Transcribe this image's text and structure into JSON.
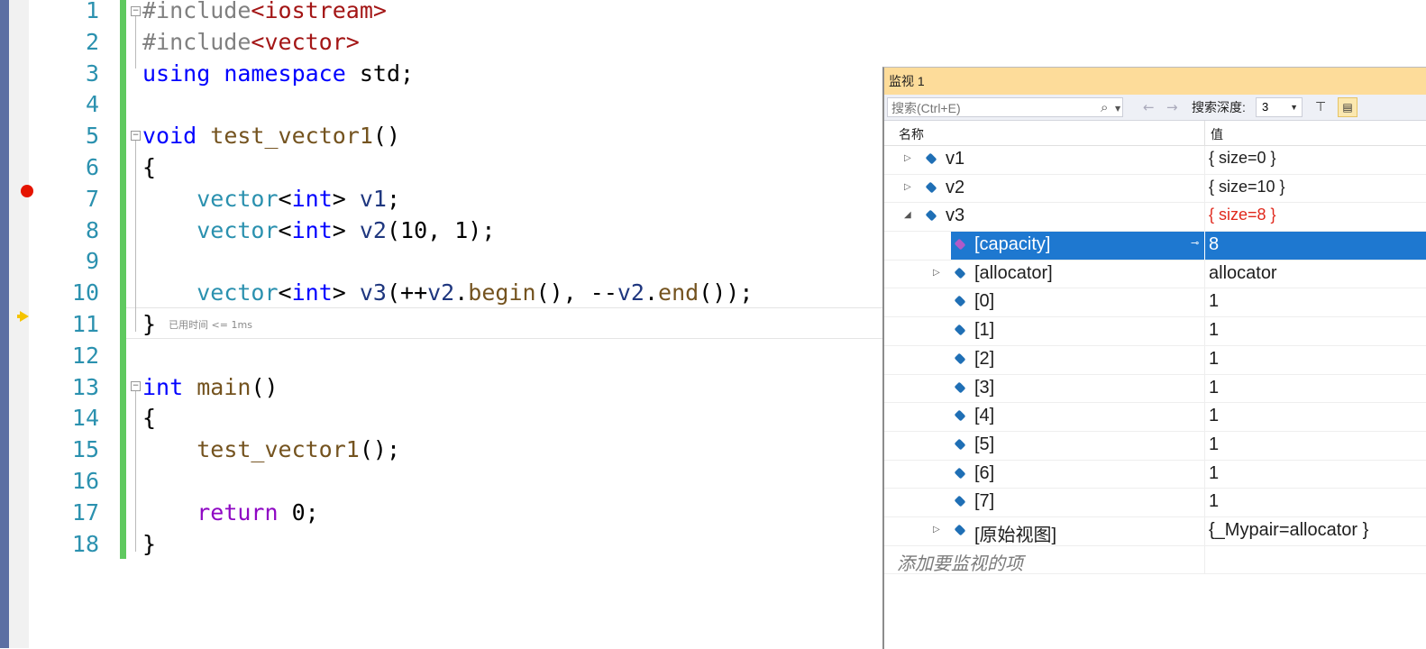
{
  "editor": {
    "line_numbers": [
      "1",
      "2",
      "3",
      "4",
      "5",
      "6",
      "7",
      "8",
      "9",
      "10",
      "11",
      "12",
      "13",
      "14",
      "15",
      "16",
      "17",
      "18"
    ],
    "lines": {
      "l1": {
        "pp": "#include",
        "inc": "<iostream>"
      },
      "l2": {
        "pp": "#include",
        "inc": "<vector>"
      },
      "l3": {
        "kw1": "using",
        "kw2": "namespace",
        "rest": " std;"
      },
      "l5": {
        "kw": "void",
        "fn": "test_vector1",
        "rest": "()"
      },
      "l6": {
        "text": "{"
      },
      "l7": {
        "typ": "vector",
        "lt": "<",
        "kw": "int",
        "gt": "> ",
        "var": "v1",
        "rest": ";"
      },
      "l8": {
        "typ": "vector",
        "lt": "<",
        "kw": "int",
        "gt": "> ",
        "var": "v2",
        "rest": "(10, 1);"
      },
      "l10": {
        "typ": "vector",
        "lt": "<",
        "kw": "int",
        "gt": "> ",
        "var": "v3",
        "p1": "(++",
        "var2": "v2",
        "dot1": ".",
        "fn1": "begin",
        "p2": "(), --",
        "var3": "v2",
        "dot2": ".",
        "fn2": "end",
        "p3": "());"
      },
      "l11": {
        "text": "}",
        "hint": "已用时间 <= 1ms"
      },
      "l13": {
        "kw": "int",
        "fn": "main",
        "rest": "()"
      },
      "l14": {
        "text": "{"
      },
      "l15": {
        "fn": "test_vector1",
        "rest": "();"
      },
      "l17": {
        "kw": "return",
        "rest": " 0;"
      },
      "l18": {
        "text": "}"
      }
    }
  },
  "watch": {
    "title": "监视 1",
    "search_placeholder": "搜索(Ctrl+E)",
    "depth_label": "搜索深度:",
    "depth_value": "3",
    "col_name": "名称",
    "col_value": "值",
    "rows": [
      {
        "name": "v1",
        "value": "{ size=0 }"
      },
      {
        "name": "v2",
        "value": "{ size=10 }"
      },
      {
        "name": "v3",
        "value": "{ size=8 }"
      },
      {
        "name": "[capacity]",
        "value": "8"
      },
      {
        "name": "[allocator]",
        "value": "allocator"
      },
      {
        "name": "[0]",
        "value": "1"
      },
      {
        "name": "[1]",
        "value": "1"
      },
      {
        "name": "[2]",
        "value": "1"
      },
      {
        "name": "[3]",
        "value": "1"
      },
      {
        "name": "[4]",
        "value": "1"
      },
      {
        "name": "[5]",
        "value": "1"
      },
      {
        "name": "[6]",
        "value": "1"
      },
      {
        "name": "[7]",
        "value": "1"
      },
      {
        "name": "[原始视图]",
        "value": "{_Mypair=allocator }"
      }
    ],
    "add_item_placeholder": "添加要监视的项"
  },
  "colors": {
    "accent_selected": "#1e78d0",
    "changed_value": "#e0281c",
    "title_bar": "#fddc9a"
  }
}
